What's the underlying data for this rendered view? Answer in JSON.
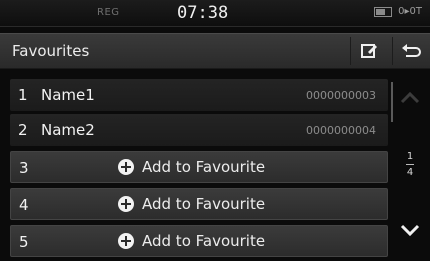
{
  "status": {
    "reg": "REG",
    "time": "07:38",
    "signal": "0▸0T"
  },
  "header": {
    "title": "Favourites"
  },
  "list": {
    "named": [
      {
        "num": "1",
        "name": "Name1",
        "phone": "0000000003"
      },
      {
        "num": "2",
        "name": "Name2",
        "phone": "0000000004"
      }
    ],
    "add": [
      {
        "num": "3",
        "label": "Add to Favourite"
      },
      {
        "num": "4",
        "label": "Add to Favourite"
      },
      {
        "num": "5",
        "label": "Add to Favourite"
      }
    ]
  },
  "pager": {
    "current": "1",
    "total": "4"
  },
  "icons": [
    "edit-icon",
    "back-icon",
    "chevron-up-icon",
    "chevron-down-icon",
    "plus-circle-icon",
    "battery-icon"
  ]
}
